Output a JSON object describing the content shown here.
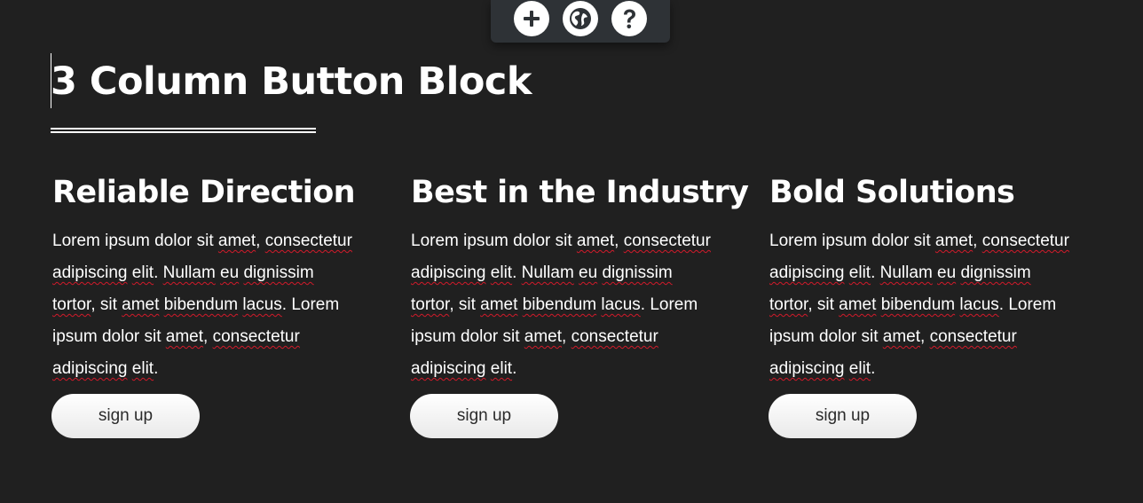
{
  "toolbar": {
    "buttons": [
      {
        "icon": "plus-icon"
      },
      {
        "icon": "globe-icon"
      },
      {
        "icon": "question-icon"
      }
    ]
  },
  "heading": {
    "title": "3 Column Button Block"
  },
  "columns": [
    {
      "heading": "Reliable Direction",
      "text_lines": [
        [
          {
            "t": "Lorem ipsum dolor sit "
          },
          {
            "t": "amet",
            "sq": true
          },
          {
            "t": ", "
          },
          {
            "t": "consectetur",
            "sq": true
          }
        ],
        [
          {
            "t": "adipiscing",
            "sq": true
          },
          {
            "t": " "
          },
          {
            "t": "elit",
            "sq": true
          },
          {
            "t": ". "
          },
          {
            "t": "Nullam",
            "sq": true
          },
          {
            "t": " "
          },
          {
            "t": "eu",
            "sq": true
          },
          {
            "t": " "
          },
          {
            "t": "dignissim",
            "sq": true
          }
        ],
        [
          {
            "t": "tortor",
            "sq": true
          },
          {
            "t": ", sit "
          },
          {
            "t": "amet",
            "sq": true
          },
          {
            "t": " "
          },
          {
            "t": "bibendum",
            "sq": true
          },
          {
            "t": " "
          },
          {
            "t": "lacus",
            "sq": true
          },
          {
            "t": ". Lorem"
          }
        ],
        [
          {
            "t": "ipsum dolor sit "
          },
          {
            "t": "amet",
            "sq": true
          },
          {
            "t": ", "
          },
          {
            "t": "consectetur",
            "sq": true
          }
        ],
        [
          {
            "t": "adipiscing",
            "sq": true
          },
          {
            "t": " "
          },
          {
            "t": "elit",
            "sq": true
          },
          {
            "t": "."
          }
        ]
      ],
      "button_label": "sign up"
    },
    {
      "heading": "Best in the Industry",
      "text_lines": [
        [
          {
            "t": "Lorem ipsum dolor sit "
          },
          {
            "t": "amet",
            "sq": true
          },
          {
            "t": ", "
          },
          {
            "t": "consectetur",
            "sq": true
          }
        ],
        [
          {
            "t": "adipiscing",
            "sq": true
          },
          {
            "t": " "
          },
          {
            "t": "elit",
            "sq": true
          },
          {
            "t": ". "
          },
          {
            "t": "Nullam",
            "sq": true
          },
          {
            "t": " "
          },
          {
            "t": "eu",
            "sq": true
          },
          {
            "t": " "
          },
          {
            "t": "dignissim",
            "sq": true
          }
        ],
        [
          {
            "t": "tortor",
            "sq": true
          },
          {
            "t": ", sit "
          },
          {
            "t": "amet",
            "sq": true
          },
          {
            "t": " "
          },
          {
            "t": "bibendum",
            "sq": true
          },
          {
            "t": " "
          },
          {
            "t": "lacus",
            "sq": true
          },
          {
            "t": ". Lorem"
          }
        ],
        [
          {
            "t": "ipsum dolor sit "
          },
          {
            "t": "amet",
            "sq": true
          },
          {
            "t": ", "
          },
          {
            "t": "consectetur",
            "sq": true
          }
        ],
        [
          {
            "t": "adipiscing",
            "sq": true
          },
          {
            "t": " "
          },
          {
            "t": "elit",
            "sq": true
          },
          {
            "t": "."
          }
        ]
      ],
      "button_label": "sign up"
    },
    {
      "heading": "Bold Solutions",
      "text_lines": [
        [
          {
            "t": "Lorem ipsum dolor sit "
          },
          {
            "t": "amet",
            "sq": true
          },
          {
            "t": ", "
          },
          {
            "t": "consectetur",
            "sq": true
          }
        ],
        [
          {
            "t": "adipiscing",
            "sq": true
          },
          {
            "t": " "
          },
          {
            "t": "elit",
            "sq": true
          },
          {
            "t": ". "
          },
          {
            "t": "Nullam",
            "sq": true
          },
          {
            "t": " "
          },
          {
            "t": "eu",
            "sq": true
          },
          {
            "t": " "
          },
          {
            "t": "dignissim",
            "sq": true
          }
        ],
        [
          {
            "t": "tortor",
            "sq": true
          },
          {
            "t": ", sit "
          },
          {
            "t": "amet",
            "sq": true
          },
          {
            "t": " "
          },
          {
            "t": "bibendum",
            "sq": true
          },
          {
            "t": " "
          },
          {
            "t": "lacus",
            "sq": true
          },
          {
            "t": ". Lorem"
          }
        ],
        [
          {
            "t": "ipsum dolor sit "
          },
          {
            "t": "amet",
            "sq": true
          },
          {
            "t": ", "
          },
          {
            "t": "consectetur",
            "sq": true
          }
        ],
        [
          {
            "t": "adipiscing",
            "sq": true
          },
          {
            "t": " "
          },
          {
            "t": "elit",
            "sq": true
          },
          {
            "t": "."
          }
        ]
      ],
      "button_label": "sign up"
    }
  ],
  "colors": {
    "background": "#202020",
    "toolbar": "#2e3236",
    "spellcheck_underline": "#d11a2a",
    "button_text": "#2b2b2b"
  }
}
